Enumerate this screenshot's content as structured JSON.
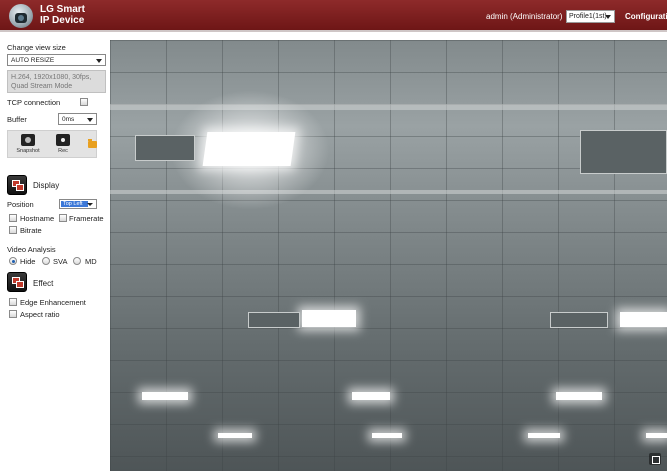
{
  "header": {
    "brand_line1": "LG Smart",
    "brand_line2": "IP Device",
    "user_label": "admin (Administrator)",
    "profile_selected": "Profile1(1st)",
    "config_label": "Configuration"
  },
  "sidebar": {
    "view_size_label": "Change view size",
    "view_size_selected": "AUTO RESIZE",
    "stream_info_line1": "H.264, 1920x1080, 30fps,",
    "stream_info_line2": "Quad Stream Mode",
    "tcp_label": "TCP connection",
    "buffer_label": "Buffer",
    "buffer_selected": "0ms",
    "snapshot_label": "Snapshot",
    "rec_label": "Rec",
    "display_title": "Display",
    "position_label": "Position",
    "position_selected": "Top Left",
    "hostname_label": "Hostname",
    "framerate_label": "Framerate",
    "bitrate_label": "Bitrate",
    "video_analysis_label": "Video Analysis",
    "va_options": [
      "Hide",
      "SVA",
      "MD"
    ],
    "va_selected": "Hide",
    "effect_title": "Effect",
    "edge_label": "Edge Enhancement",
    "aspect_label": "Aspect ratio"
  },
  "icons": {
    "logo": "camera-logo-icon",
    "snapshot": "camera-icon",
    "rec": "record-icon",
    "folder": "folder-icon",
    "display": "display-icon",
    "effect": "effect-icon",
    "fullscreen": "fullscreen-icon"
  },
  "colors": {
    "header": "#7a1d1d",
    "accent": "#3c78d8"
  }
}
